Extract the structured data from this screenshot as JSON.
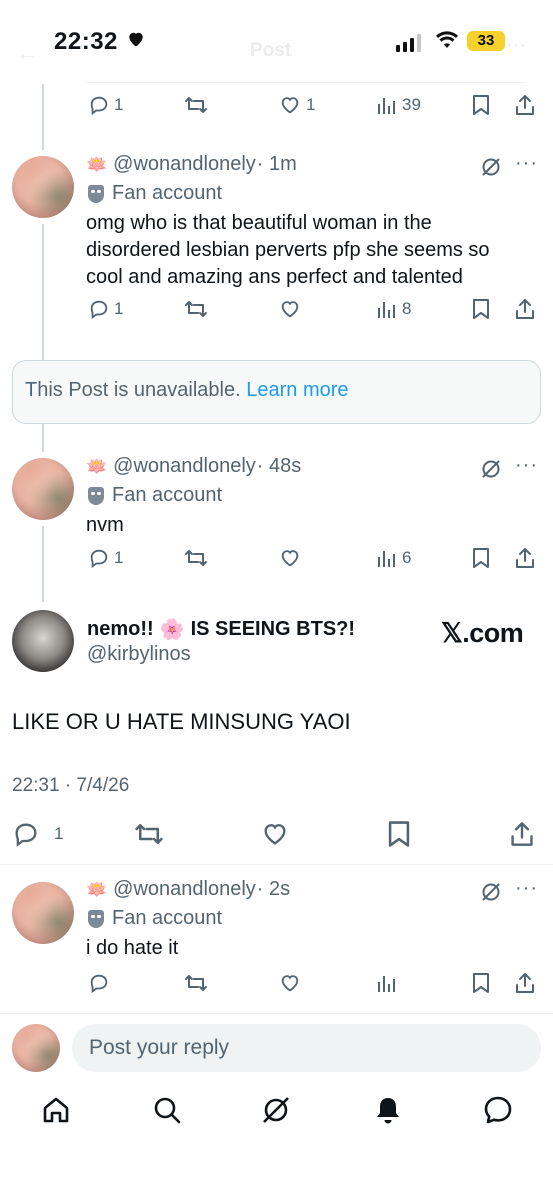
{
  "status_bar": {
    "time": "22:32",
    "battery": "33"
  },
  "header": {
    "title": "Post"
  },
  "replies": [
    {
      "actions": {
        "replies": "1",
        "likes": "1",
        "views": "39"
      }
    },
    {
      "handle": "@wonandlonely",
      "time": "· 1m",
      "label": "Fan account",
      "text": "omg who is that beautiful woman in the disordered lesbian perverts pfp she seems so cool and amazing ans perfect and talented",
      "actions": {
        "replies": "1",
        "likes": "",
        "views": "8"
      }
    },
    {
      "handle": "@wonandlonely",
      "time": "· 48s",
      "label": "Fan account",
      "text": "nvm",
      "actions": {
        "replies": "1",
        "likes": "",
        "views": "6"
      }
    }
  ],
  "unavailable": {
    "text": "This Post is unavailable.",
    "link": "Learn more"
  },
  "main_post": {
    "name_prefix": "nemo!!",
    "name_emoji": "🌸",
    "name_suffix": "IS SEEING BTS?!",
    "handle": "@kirbylinos",
    "watermark": "𝕏.com",
    "text": "LIKE OR U HATE MINSUNG YAOI",
    "timestamp": "22:31 · 7/4/26",
    "replies": "1"
  },
  "last_reply": {
    "handle": "@wonandlonely",
    "time": "· 2s",
    "label": "Fan account",
    "text": "i do hate it"
  },
  "composer": {
    "placeholder": "Post your reply"
  },
  "colors": {
    "secondary_text": "#536471",
    "link": "#1d9bf0",
    "battery": "#f4d22b"
  },
  "icons": [
    "reply-icon",
    "retweet-icon",
    "like-icon",
    "views-icon",
    "bookmark-icon",
    "share-icon",
    "grok-icon",
    "home-icon",
    "search-icon",
    "notifications-icon",
    "messages-icon"
  ]
}
